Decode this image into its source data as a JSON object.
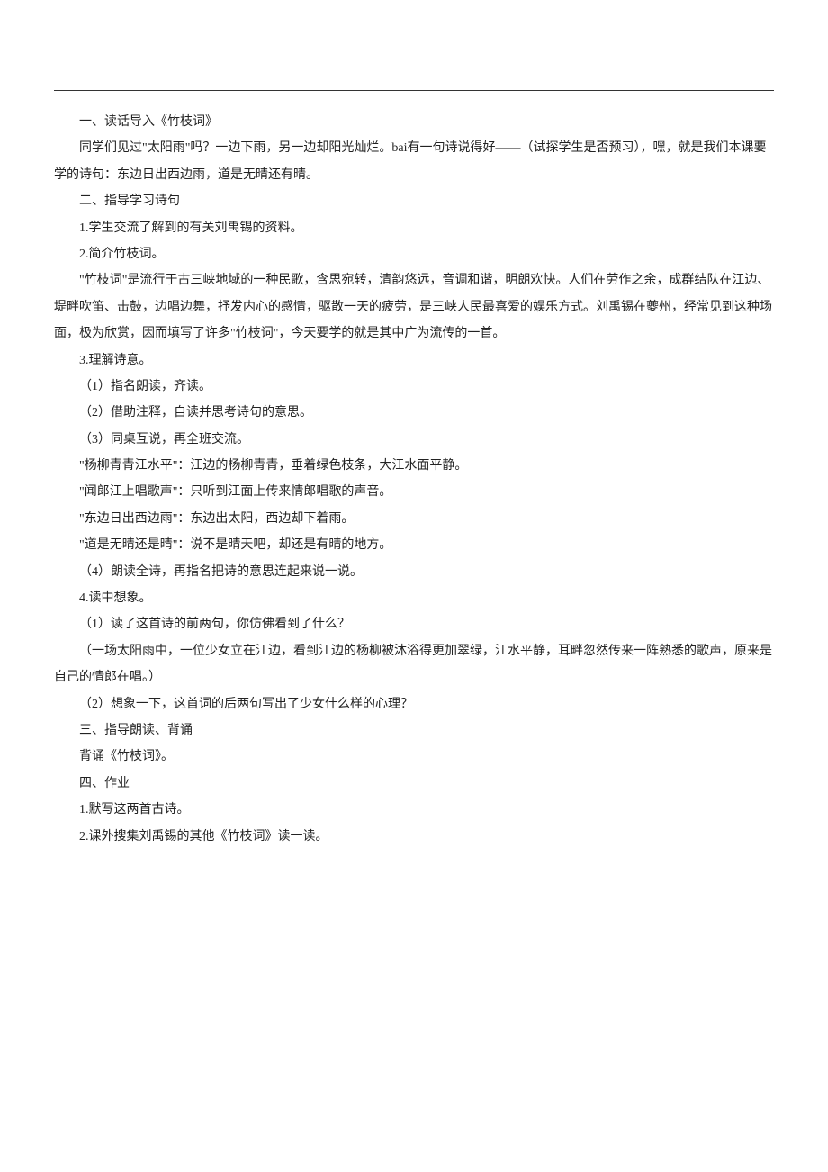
{
  "lines": {
    "l1": "一、读话导入《竹枝词》",
    "l2": "同学们见过\"太阳雨\"吗？一边下雨，另一边却阳光灿烂。bai有一句诗说得好——（试探学生是否预习），嘿，就是我们本课要学的诗句：东边日出西边雨，道是无晴还有晴。",
    "l3": "二、指导学习诗句",
    "l4": "1.学生交流了解到的有关刘禹锡的资料。",
    "l5": "2.简介竹枝词。",
    "l6": "\"竹枝词\"是流行于古三峡地域的一种民歌，含思宛转，清韵悠远，音调和谐，明朗欢快。人们在劳作之余，成群结队在江边、堤畔吹笛、击鼓，边唱边舞，抒发内心的感情，驱散一天的疲劳，是三峡人民最喜爱的娱乐方式。刘禹锡在夔州，经常见到这种场面，极为欣赏，因而填写了许多\"竹枝词\"，今天要学的就是其中广为流传的一首。",
    "l7": "3.理解诗意。",
    "l8": "（1）指名朗读，齐读。",
    "l9": "（2）借助注释，自读并思考诗句的意思。",
    "l10": "（3）同桌互说，再全班交流。",
    "l11": "\"杨柳青青江水平\"：江边的杨柳青青，垂着绿色枝条，大江水面平静。",
    "l12": "\"闻郎江上唱歌声\"：只听到江面上传来情郎唱歌的声音。",
    "l13": "\"东边日出西边雨\"：东边出太阳，西边却下着雨。",
    "l14": "\"道是无晴还是晴\"：说不是晴天吧，却还是有晴的地方。",
    "l15": "（4）朗读全诗，再指名把诗的意思连起来说一说。",
    "l16": "4.读中想象。",
    "l17": "（1）读了这首诗的前两句，你仿佛看到了什么？",
    "l18": "（一场太阳雨中，一位少女立在江边，看到江边的杨柳被沐浴得更加翠绿，江水平静，耳畔忽然传来一阵熟悉的歌声，原来是自己的情郎在唱。）",
    "l19": "（2）想象一下，这首词的后两句写出了少女什么样的心理？",
    "l20": "三、指导朗读、背诵",
    "l21": "背诵《竹枝词》。",
    "l22": "四、作业",
    "l23": "1.默写这两首古诗。",
    "l24": "2.课外搜集刘禹锡的其他《竹枝词》读一读。"
  }
}
